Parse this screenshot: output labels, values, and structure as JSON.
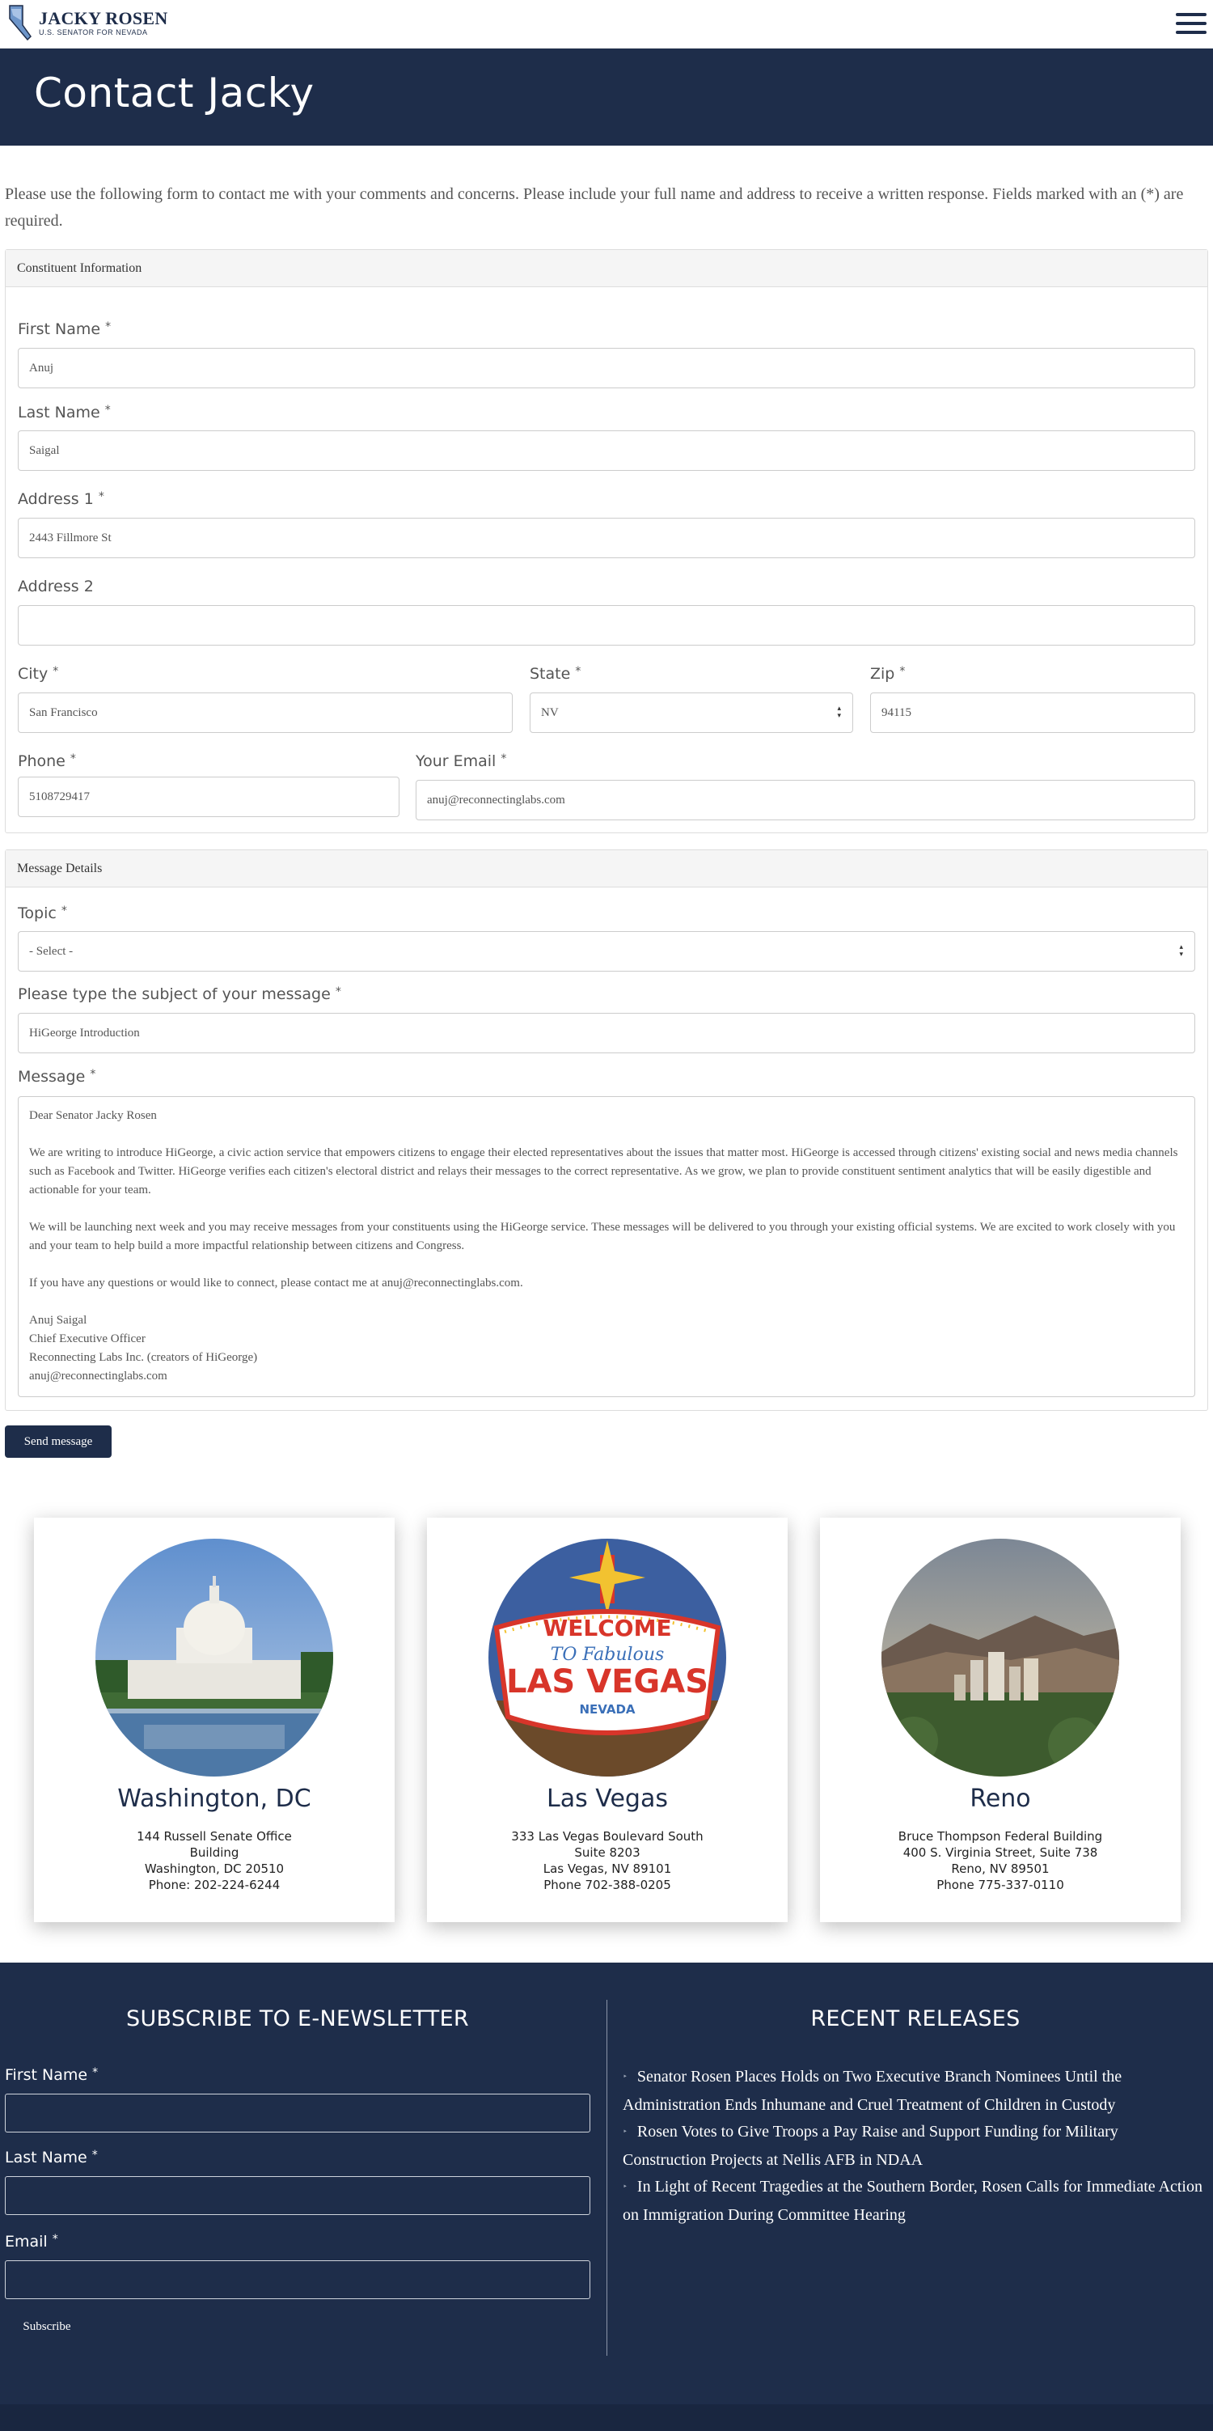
{
  "header": {
    "logo_name": "JACKY ROSEN",
    "logo_sub": "U.S. SENATOR FOR NEVADA"
  },
  "hero": {
    "title": "Contact Jacky"
  },
  "intro": "Please use the following form to contact me with your comments and concerns. Please include your full name and address to receive a written response. Fields marked with an (*) are required.",
  "constituent": {
    "heading": "Constituent Information",
    "first_name": {
      "label": "First Name",
      "value": "Anuj"
    },
    "last_name": {
      "label": "Last Name",
      "value": "Saigal"
    },
    "address1": {
      "label": "Address 1",
      "value": "2443 Fillmore St"
    },
    "address2": {
      "label": "Address 2",
      "value": ""
    },
    "city": {
      "label": "City",
      "value": "San Francisco"
    },
    "state": {
      "label": "State",
      "value": "NV"
    },
    "zip": {
      "label": "Zip",
      "value": "94115"
    },
    "phone": {
      "label": "Phone",
      "value": "5108729417"
    },
    "email": {
      "label": "Your Email",
      "value": "anuj@reconnectinglabs.com"
    }
  },
  "message_details": {
    "heading": "Message Details",
    "topic": {
      "label": "Topic",
      "value": "- Select -"
    },
    "subject": {
      "label": "Please type the subject of your message",
      "value": "HiGeorge Introduction"
    },
    "message": {
      "label": "Message",
      "lines": [
        "Dear Senator Jacky Rosen",
        "",
        "We are writing to introduce HiGeorge, a civic action service that empowers citizens to engage their elected representatives about the issues that matter most. HiGeorge is accessed through citizens' existing social and news media channels such as Facebook and Twitter.  HiGeorge verifies each citizen's electoral district and relays their messages to the correct representative.  As we grow, we plan to provide constituent sentiment analytics that will be easily digestible and actionable for your team.",
        "",
        "We will be launching next week and you may receive messages from your constituents using the HiGeorge service. These messages will be delivered to you through your existing official systems. We are excited to work closely with you and your team to help build a more impactful relationship between citizens and Congress.",
        "",
        "If you have any questions or would like to connect, please contact me at anuj@reconnectinglabs.com.",
        "",
        "Anuj Saigal",
        "Chief Executive Officer",
        "Reconnecting Labs Inc. (creators of HiGeorge)",
        "anuj@reconnectinglabs.com"
      ]
    }
  },
  "send_label": "Send message",
  "offices": [
    {
      "city": "Washington, DC",
      "address": [
        "144 Russell Senate Office",
        "Building",
        "Washington, DC 20510",
        "Phone: 202-224-6244"
      ]
    },
    {
      "city": "Las Vegas",
      "address": [
        "333 Las Vegas Boulevard South",
        "Suite 8203",
        "Las Vegas, NV 89101",
        "Phone 702-388-0205"
      ]
    },
    {
      "city": "Reno",
      "address": [
        "Bruce Thompson Federal Building",
        "400 S. Virginia Street, Suite 738",
        "Reno, NV 89501",
        "Phone 775-337-0110"
      ]
    }
  ],
  "las_vegas_sign": {
    "top": "WELCOME",
    "middle": "TO Fabulous",
    "main": "LAS VEGAS",
    "bottom": "NEVADA"
  },
  "newsletter": {
    "title": "SUBSCRIBE TO E-NEWSLETTER",
    "first_name_label": "First Name",
    "last_name_label": "Last Name",
    "email_label": "Email",
    "subscribe_label": "Subscribe"
  },
  "releases": {
    "title": "RECENT RELEASES",
    "items": [
      "Senator Rosen Places Holds on Two Executive Branch Nominees Until the Administration Ends Inhumane and Cruel Treatment of Children in Custody",
      "Rosen Votes to Give Troops a Pay Raise and Support Funding for Military Construction Projects at Nellis AFB in NDAA",
      "In Light of Recent Tragedies at the Southern Border, Rosen Calls for Immediate Action on Immigration During Committee Hearing"
    ]
  },
  "colors": {
    "navy": "#1e2d4a",
    "panel_head": "#f5f5f5"
  }
}
